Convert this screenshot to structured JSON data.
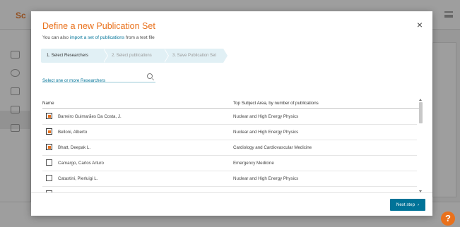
{
  "background": {
    "logo": "Sc",
    "footer_text": ""
  },
  "modal": {
    "title": "Define a new Publication Set",
    "subtitle_prefix": "You can also ",
    "subtitle_link": "import a set of publications",
    "subtitle_suffix": " from a text file",
    "close_glyph": "×"
  },
  "steps": [
    {
      "label": "1. Select Researchers"
    },
    {
      "label": "2. Select publications"
    },
    {
      "label": "3. Save Publication Set"
    }
  ],
  "search": {
    "placeholder": "Select one or more Researchers"
  },
  "table": {
    "col_name": "Name",
    "col_area": "Top Subject Area, by number of publications",
    "rows": [
      {
        "name": "Barreiro Guimarães Da Costa, J.",
        "area": "Nuclear and High Energy Physics",
        "checked": true
      },
      {
        "name": "Belloni, Alberto",
        "area": "Nuclear and High Energy Physics",
        "checked": true
      },
      {
        "name": "Bhatt, Deepak L.",
        "area": "Cardiology and Cardiovascular Medicine",
        "checked": true
      },
      {
        "name": "Camargo, Carlos Arturo",
        "area": "Emergency Medicine",
        "checked": false
      },
      {
        "name": "Catastini, Pierluigi L.",
        "area": "Nuclear and High Energy Physics",
        "checked": false
      },
      {
        "name": "",
        "area": "",
        "checked": false
      }
    ]
  },
  "footer": {
    "next_label": "Next step",
    "next_chevron": "›"
  },
  "colors": {
    "accent_orange": "#e9711c",
    "primary_blue": "#007398",
    "step_bg": "#e1f0f5"
  }
}
